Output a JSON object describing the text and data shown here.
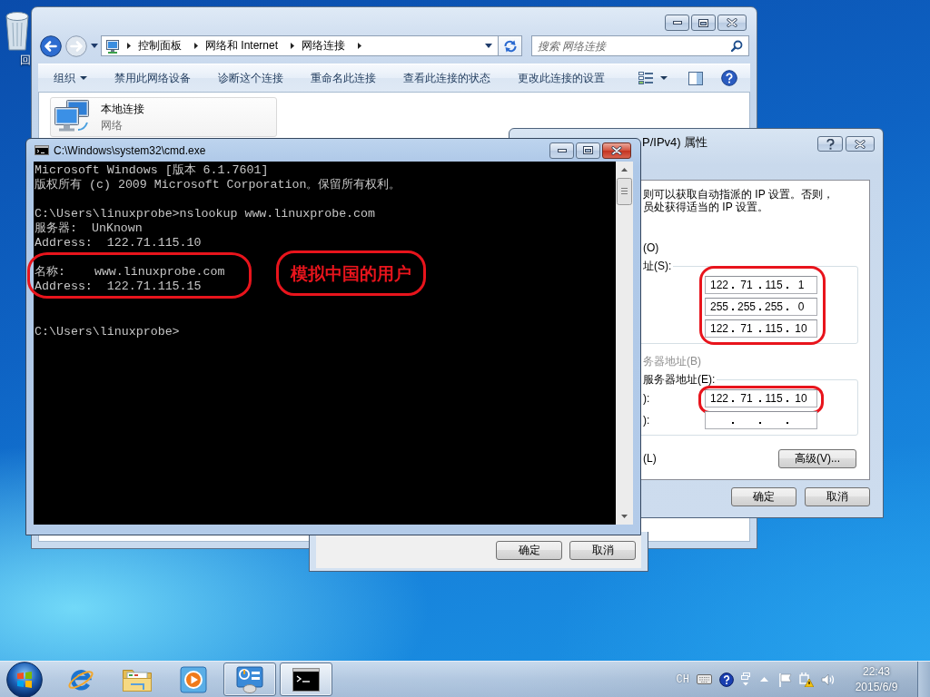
{
  "desktop": {
    "icons": [
      {
        "label": "回"
      }
    ]
  },
  "explorer": {
    "active": false,
    "breadcrumb": [
      "控制面板",
      "网络和 Internet",
      "网络连接"
    ],
    "search": {
      "placeholder": "搜索 网络连接"
    },
    "toolbar": {
      "menu": "组织",
      "commands": [
        "禁用此网络设备",
        "诊断这个连接",
        "重命名此连接",
        "查看此连接的状态",
        "更改此连接的设置"
      ]
    },
    "items": [
      {
        "name": "本地连接",
        "type": "网络",
        "selected": true
      }
    ]
  },
  "connection_dialog": {
    "buttons": [
      "确定",
      "取消"
    ]
  },
  "ipv4_dialog": {
    "active": false,
    "title": "P/IPv4) 属性",
    "intro": [
      "则可以获取自动指派的 IP 设置。否则，",
      "员处获得适当的 IP 设置。"
    ],
    "sections": [
      {
        "kind": "option",
        "label": "(O)",
        "disabled": false
      },
      {
        "kind": "group",
        "caption": "址(S):",
        "circled": true,
        "fields": [
          {
            "octets": [
              "122",
              "71",
              "115",
              "1"
            ],
            "circled": false
          },
          {
            "octets": [
              "255",
              "255",
              "255",
              "0"
            ],
            "circled": false
          },
          {
            "octets": [
              "122",
              "71",
              "115",
              "10"
            ],
            "circled": false
          }
        ]
      },
      {
        "kind": "option",
        "label": "务器地址(B)",
        "disabled": true
      },
      {
        "kind": "group",
        "caption": "服务器地址(E):",
        "circled": false,
        "fields": [
          {
            "label": "):",
            "octets": [
              "122",
              "71",
              "115",
              "10"
            ],
            "circled": true
          },
          {
            "label": "):",
            "circled": false
          }
        ]
      }
    ],
    "validate_label": "(L)",
    "advanced_button": "高级(V)...",
    "buttons": [
      "确定",
      "取消"
    ]
  },
  "cmd": {
    "active": true,
    "title": "C:\\Windows\\system32\\cmd.exe",
    "blocks": [
      {
        "circled": false,
        "lines": [
          {
            "kind": "text",
            "text": "Microsoft Windows [版本 6.1.7601]"
          },
          {
            "kind": "text",
            "text": "版权所有 (c) 2009 Microsoft Corporation。保留所有权利。"
          }
        ]
      },
      {
        "circled": false,
        "lines": [
          {
            "kind": "text",
            "text": "C:\\Users\\linuxprobe>nslookup www.linuxprobe.com"
          },
          {
            "kind": "text",
            "text": "服务器:  UnKnown"
          },
          {
            "kind": "text",
            "text": "Address:  122.71.115.10"
          }
        ]
      },
      {
        "circled": true,
        "note": "模拟中国的用户",
        "lines": [
          {
            "kind": "text",
            "text": "名称:    www.linuxprobe.com"
          },
          {
            "kind": "text",
            "text": "Address:  122.71.115.15"
          }
        ]
      },
      {
        "circled": false,
        "lines": [
          {
            "kind": "blank"
          },
          {
            "kind": "text",
            "text": "C:\\Users\\linuxprobe>"
          }
        ]
      }
    ]
  },
  "taskbar": {
    "buttons": [
      {
        "kind": "browser",
        "running": false,
        "active": false
      },
      {
        "kind": "folder",
        "running": false,
        "active": false
      },
      {
        "kind": "media",
        "running": false,
        "active": false
      },
      {
        "kind": "control-panel",
        "running": true,
        "active": false
      },
      {
        "kind": "console",
        "running": true,
        "active": true
      }
    ],
    "tray": {
      "language": "CH",
      "time": "22:43",
      "date": "2015/6/9"
    }
  }
}
